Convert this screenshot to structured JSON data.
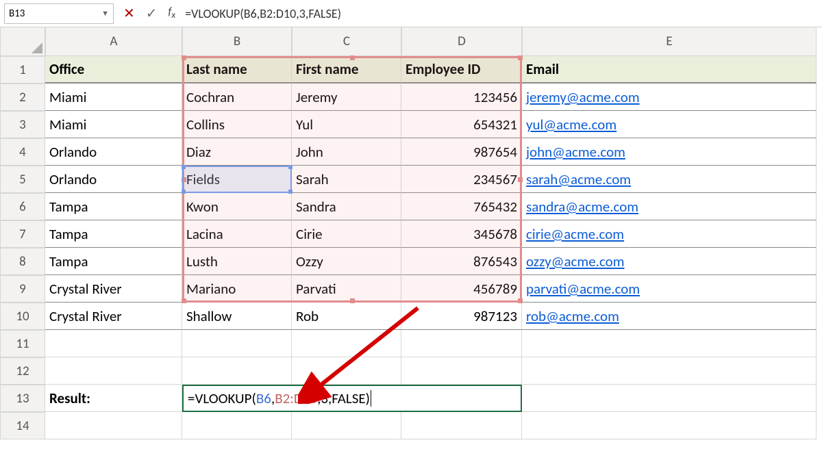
{
  "name_box": "B13",
  "formula_bar_text": "=VLOOKUP(B6,B2:D10,3,FALSE)",
  "columns": [
    "A",
    "B",
    "C",
    "D",
    "E"
  ],
  "row_numbers": [
    1,
    2,
    3,
    4,
    5,
    6,
    7,
    8,
    9,
    10,
    11,
    12,
    13,
    14
  ],
  "headers": {
    "A": "Office",
    "B": "Last name",
    "C": "First name",
    "D": "Employee ID",
    "E": "Email"
  },
  "rows": [
    {
      "A": "Miami",
      "B": "Cochran",
      "C": "Jeremy",
      "D": 123456,
      "E": "jeremy@acme.com"
    },
    {
      "A": "Miami",
      "B": "Collins",
      "C": "Yul",
      "D": 654321,
      "E": "yul@acme.com"
    },
    {
      "A": "Orlando",
      "B": "Diaz",
      "C": "John",
      "D": 987654,
      "E": "john@acme.com"
    },
    {
      "A": "Orlando",
      "B": "Fields",
      "C": "Sarah",
      "D": 234567,
      "E": "sarah@acme.com"
    },
    {
      "A": "Tampa",
      "B": "Kwon",
      "C": "Sandra",
      "D": 765432,
      "E": "sandra@acme.com"
    },
    {
      "A": "Tampa",
      "B": "Lacina",
      "C": "Cirie",
      "D": 345678,
      "E": "cirie@acme.com"
    },
    {
      "A": "Tampa",
      "B": "Lusth",
      "C": "Ozzy",
      "D": 876543,
      "E": "ozzy@acme.com"
    },
    {
      "A": "Crystal River",
      "B": "Mariano",
      "C": "Parvati",
      "D": 456789,
      "E": "parvati@acme.com"
    },
    {
      "A": "Crystal River",
      "B": "Shallow",
      "C": "Rob",
      "D": 987123,
      "E": "rob@acme.com"
    }
  ],
  "result_label": "Result:",
  "edit_parts": {
    "prefix": "=VLOOKUP(",
    "arg1": "B6",
    "c1": ",",
    "arg2": "B2:D10",
    "c2": ",",
    "arg3": "3",
    "c3": ",",
    "arg4": "FALSE",
    "suffix": ")"
  }
}
